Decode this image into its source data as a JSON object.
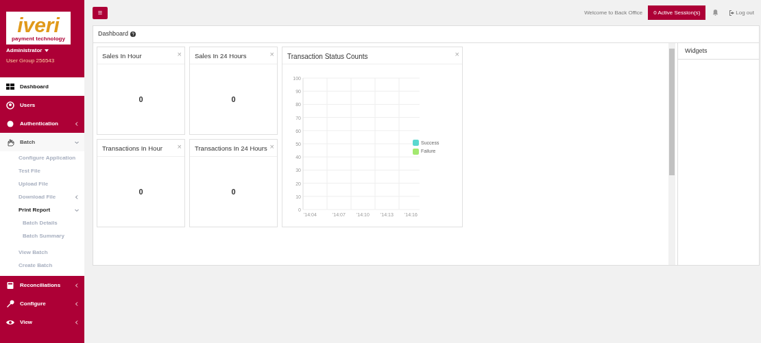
{
  "sidebar": {
    "logo": {
      "wordmark": "iveri",
      "tagline": "payment technology"
    },
    "user": "Administrator",
    "group": "User Group 256543",
    "items": [
      {
        "label": "Dashboard",
        "selected": true
      },
      {
        "label": "Users",
        "selected": false
      },
      {
        "label": "Authentication",
        "selected": false,
        "expanded": false
      },
      {
        "label": "Batch",
        "selected": false,
        "expanded": true,
        "children": [
          {
            "label": "Configure Application"
          },
          {
            "label": "Test File"
          },
          {
            "label": "Upload File"
          },
          {
            "label": "Download File",
            "expanded": false
          },
          {
            "label": "Print Report",
            "expanded": true,
            "children": [
              {
                "label": "Batch Details"
              },
              {
                "label": "Batch Summary"
              }
            ]
          },
          {
            "label": "View Batch"
          },
          {
            "label": "Create Batch"
          }
        ]
      },
      {
        "label": "Reconciliations",
        "selected": false,
        "expanded": false
      },
      {
        "label": "Configure",
        "selected": false,
        "expanded": false
      },
      {
        "label": "View",
        "selected": false,
        "expanded": false
      }
    ]
  },
  "topbar": {
    "menu_button": "≡",
    "welcome": "Welcome to Back Office",
    "sessions": "0 Active Session(s)",
    "logout": "Log out"
  },
  "panel": {
    "title": "Dashboard",
    "cards": [
      {
        "title": "Sales In Hour",
        "close": "×",
        "value": "0"
      },
      {
        "title": "Sales In 24 Hours",
        "close": "×",
        "value": "0"
      },
      {
        "title": "Transactions In Hour",
        "close": "×",
        "value": "0"
      },
      {
        "title": "Transactions In 24 Hours",
        "close": "×",
        "value": "0"
      }
    ],
    "chart_card": {
      "title": "Transaction Status Counts",
      "close": "×",
      "chart_data": {
        "type": "line",
        "grid": true,
        "categories": [
          "'14:04",
          "'14:07",
          "'14:10",
          "'14:13",
          "'14:16"
        ],
        "ylim": [
          0,
          100
        ],
        "yticks": [
          0,
          10,
          20,
          30,
          40,
          50,
          60,
          70,
          80,
          90,
          100
        ],
        "series": [
          {
            "name": "Success",
            "color": "#5ad8cf",
            "values": [
              null,
              null,
              null,
              null,
              null
            ]
          },
          {
            "name": "Failure",
            "color": "#a3e86f",
            "values": [
              null,
              null,
              null,
              null,
              null
            ]
          }
        ]
      }
    },
    "widgets": {
      "title": "Widgets"
    }
  }
}
